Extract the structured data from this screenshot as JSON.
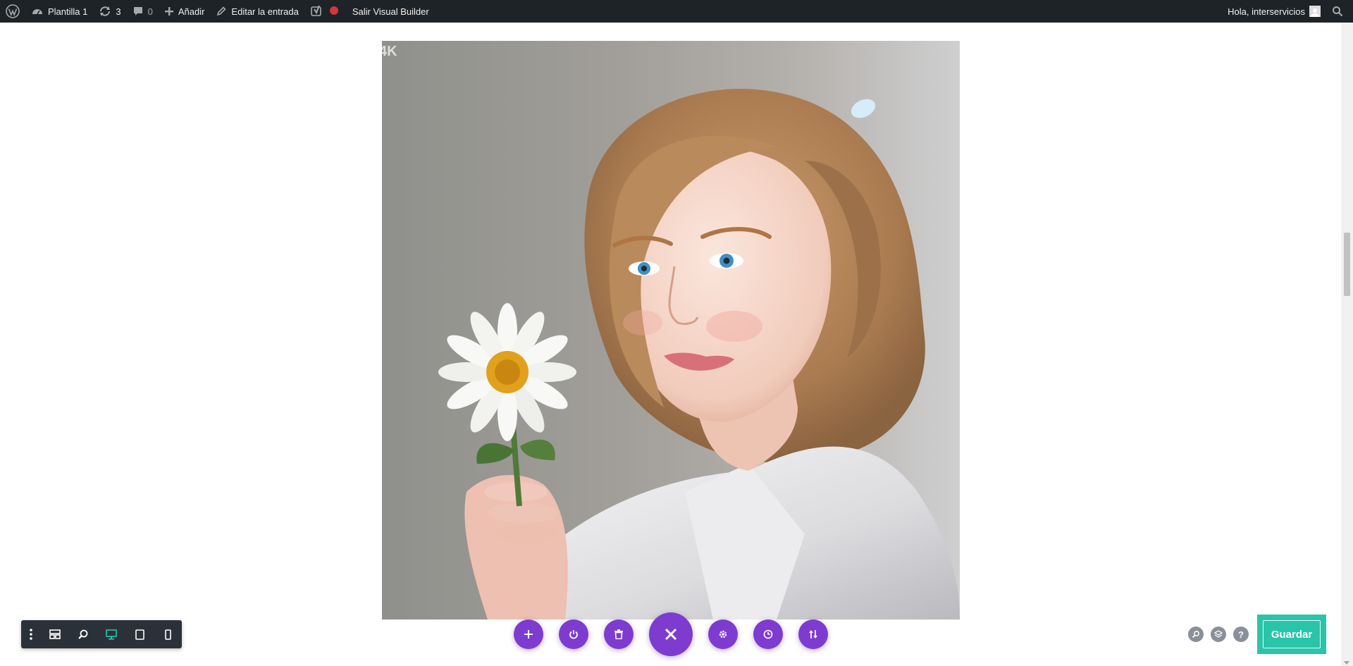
{
  "admin_bar": {
    "site_name": "Plantilla 1",
    "updates_count": "3",
    "comments_count": "0",
    "add_label": "Añadir",
    "edit_label": "Editar la entrada",
    "exit_builder_label": "Salir Visual Builder",
    "greeting": "Hola, interservicios"
  },
  "content": {
    "image_watermark": "4K"
  },
  "builder": {
    "save_label": "Guardar",
    "help_label": "?"
  },
  "colors": {
    "admin_bar_bg": "#1d2327",
    "purple_accent": "#7e3bd0",
    "save_green": "#29c4a9",
    "toolbar_dark": "#2b3138",
    "desktop_active": "#29c4a9"
  },
  "icons": {
    "left_toolbar": [
      "more-vertical-icon",
      "layout-icon",
      "zoom-icon",
      "desktop-icon",
      "tablet-icon",
      "phone-icon"
    ],
    "center_controls": [
      "add-icon",
      "power-icon",
      "trash-icon",
      "close-icon",
      "settings-icon",
      "history-icon",
      "sort-icon"
    ],
    "right_controls": [
      "search-icon",
      "layers-icon",
      "help-icon"
    ]
  }
}
